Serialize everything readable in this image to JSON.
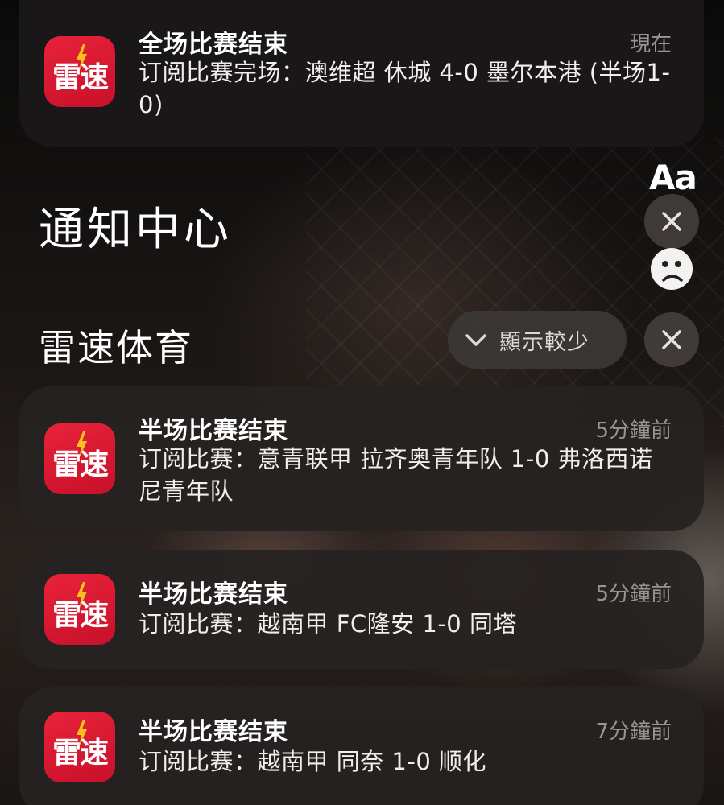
{
  "top_notification": {
    "icon_label": "雷速",
    "title": "全场比赛结束",
    "time": "現在",
    "body": "订阅比赛完场：澳维超 休城 4-0 墨尔本港 (半场1-0)"
  },
  "notification_center": {
    "heading": "通知中心",
    "text_size_button": "Aa"
  },
  "app_group": {
    "name": "雷速体育",
    "show_less_label": "顯示較少"
  },
  "notifications": [
    {
      "icon_label": "雷速",
      "title": "半场比赛结束",
      "time": "5分鐘前",
      "body": "订阅比赛：意青联甲 拉齐奥青年队 1-0 弗洛西诺尼青年队"
    },
    {
      "icon_label": "雷速",
      "title": "半场比赛结束",
      "time": "5分鐘前",
      "body": "订阅比赛：越南甲 FC隆安 1-0 同塔"
    },
    {
      "icon_label": "雷速",
      "title": "半场比赛结束",
      "time": "7分鐘前",
      "body": "订阅比赛：越南甲 同奈 1-0 顺化"
    }
  ],
  "colors": {
    "icon_red": "#e8233a",
    "bolt_yellow": "#f7c21b",
    "secondary_text": "#9a9593"
  }
}
